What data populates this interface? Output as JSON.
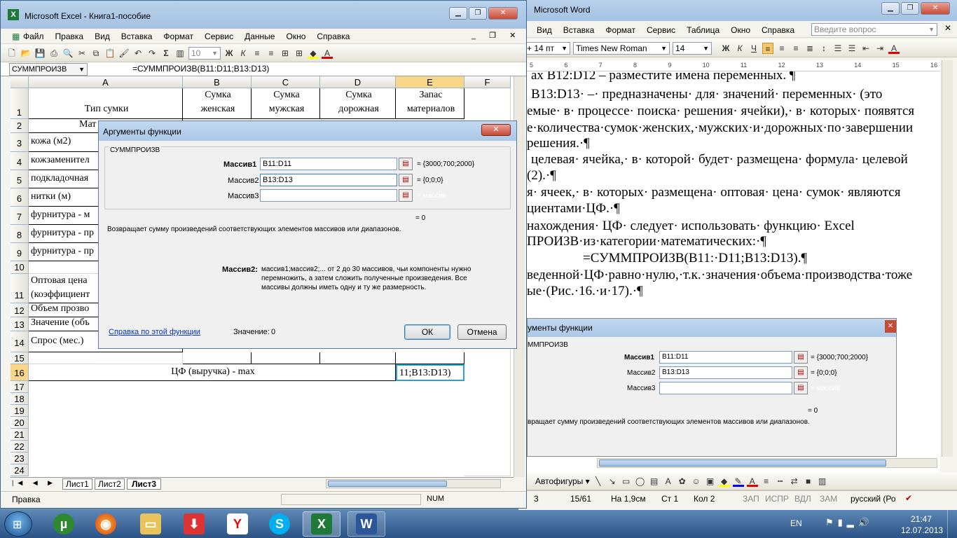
{
  "excel": {
    "title": "Microsoft Excel - Книга1-пособие",
    "menu": [
      "Файл",
      "Правка",
      "Вид",
      "Вставка",
      "Формат",
      "Сервис",
      "Данные",
      "Окно",
      "Справка"
    ],
    "font_size": "10",
    "name_box": "СУММПРОИЗВ",
    "formula": "=СУММПРОИЗВ(B11:D11;B13:D13)",
    "columns": [
      "A",
      "B",
      "C",
      "D",
      "E",
      "F"
    ],
    "rows": [
      "1",
      "2",
      "3",
      "4",
      "5",
      "6",
      "7",
      "8",
      "9",
      "10",
      "11",
      "12",
      "13",
      "14",
      "15",
      "16",
      "17",
      "18",
      "19",
      "20",
      "21",
      "22",
      "23",
      "24"
    ],
    "header_row": {
      "a1": "Тип сумки",
      "b1a": "Сумка",
      "b1b": "женская",
      "c1a": "Сумка",
      "c1b": "мужская",
      "d1a": "Сумка",
      "d1b": "дорожная",
      "e1a": "Запас",
      "e1b": "материалов"
    },
    "cells": {
      "a2": "Мат",
      "a3": "кожа (м2)",
      "a4": "кожзаменител",
      "a5": "подкладочная",
      "a6": "нитки (м)",
      "a7": "фурнитура - м",
      "a8": "фурнитура - пр",
      "a9": "фурнитура - пр",
      "a11a": "Оптовая цена",
      "a11b": "(коэффициент",
      "a12": "Объем прозво",
      "a13": "Значение (объ",
      "a14": "Спрос (мес.)",
      "a16": "ЦФ (выручка) - max",
      "e16": "11;B13:D13)"
    },
    "sheets": [
      "Лист1",
      "Лист2",
      "Лист3"
    ],
    "active_sheet": "Лист3",
    "status": "Правка",
    "num": "NUM"
  },
  "dialog": {
    "title": "Аргументы функции",
    "group": "СУММПРОИЗВ",
    "args": [
      {
        "label": "Массив1",
        "value": "B11:D11",
        "result": "= {3000;700;2000}"
      },
      {
        "label": "Массив2",
        "value": "B13:D13",
        "result": "= {0;0;0}"
      },
      {
        "label": "Массив3",
        "value": "",
        "result": "= массив"
      }
    ],
    "total": "= 0",
    "description": "Возвращает сумму произведений соответствующих элементов массивов или диапазонов.",
    "arg_help_label": "Массив2:",
    "arg_help_lines": [
      "массив1;массив2;... от 2 до 30 массивов, чьи компоненты нужно",
      "перемножить, а затем сложить полученные произведения. Все",
      "массивы должны иметь одну и ту же размерность."
    ],
    "help_link": "Справка по этой функции",
    "value_label": "Значение:",
    "value": "0",
    "ok": "ОК",
    "cancel": "Отмена"
  },
  "word": {
    "title": "Microsoft Word",
    "menu": [
      "Вид",
      "Вставка",
      "Формат",
      "Сервис",
      "Таблица",
      "Окно",
      "Справка"
    ],
    "ask_placeholder": "Введите вопрос",
    "style_combo": "+ 14 пт",
    "font_combo": "Times New Roman",
    "size_combo": "14",
    "ruler": [
      "5",
      "6",
      "7",
      "8",
      "9",
      "10",
      "11",
      "12",
      "13",
      "14",
      "15",
      "16"
    ],
    "lines": [
      "ах B12:D12 – разместите имена переменных. ¶",
      "B13:D13· –· предназначены· для· значений· переменных· (это",
      "емые· в· процессе· поиска· решения· ячейки),· в· которых· появятся",
      "е·количества·сумок·женских,·мужских·и·дорожных·по·завершении",
      "решения.·¶",
      "целевая· ячейка,· в· которой· будет· размещена· формула· целевой",
      "(2).·¶",
      "я· ячеек,· в· которых· размещена· оптовая· цена· сумок· являются",
      "циентами·ЦФ.·¶",
      "нахождения· ЦФ· следует· использовать· функцию· Excel",
      "ПРОИЗВ·из·категории·математических:·¶",
      "=СУММПРОИЗВ(B11:·D11;B13:D13).¶",
      "веденной·ЦФ·равно·нулю,·т.к.·значения·объема·производства·тоже",
      "ые·(Рис.·16.·и·17).·¶"
    ],
    "img_title": "ументы функции",
    "img_group": "ММПРОИЗВ",
    "img_desc": "вращает сумму произведений соответствующих элементов массивов или диапазонов.",
    "drawing": "Автофигуры",
    "status": [
      "3",
      "15/61",
      "На 1,9см",
      "Ст 1",
      "Кол 2",
      "ЗАП",
      "ИСПР",
      "ВДЛ",
      "ЗАМ",
      "русский (Ро"
    ]
  },
  "taskbar": {
    "lang": "EN",
    "time": "21:47",
    "date": "12.07.2013"
  }
}
